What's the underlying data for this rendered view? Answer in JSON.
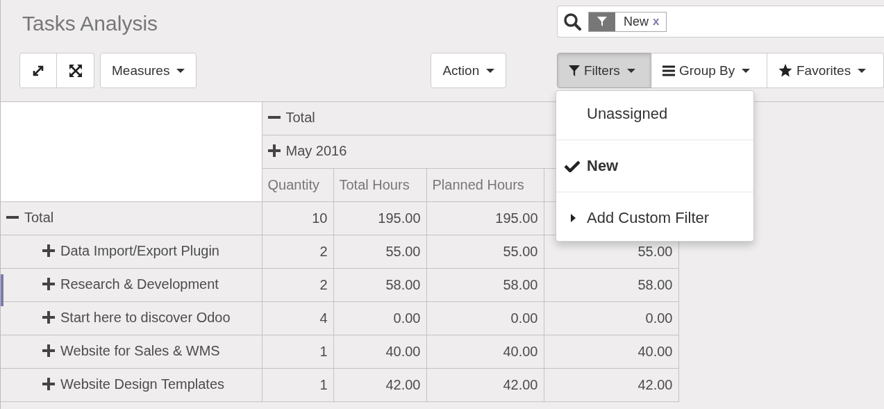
{
  "title": "Tasks Analysis",
  "measures_button": {
    "label": "Measures"
  },
  "action_button": {
    "label": "Action"
  },
  "search": {
    "facets": [
      {
        "label": "New",
        "remove": "x"
      }
    ]
  },
  "search_buttons": [
    {
      "label": "Filters",
      "kind": "filter",
      "selected": true
    },
    {
      "label": "Group By",
      "kind": "group",
      "selected": false
    },
    {
      "label": "Favorites",
      "kind": "star",
      "selected": false
    }
  ],
  "filter_menu": [
    {
      "label": "Unassigned",
      "kind": "option",
      "checked": false
    },
    {
      "label": "New",
      "kind": "option",
      "checked": true
    },
    {
      "label": "Add Custom Filter",
      "kind": "custom",
      "checked": false
    }
  ],
  "table": {
    "column_groups": [
      {
        "label": "Total",
        "expanded": true
      },
      {
        "label": "May 2016",
        "expanded": false
      }
    ],
    "columns": [
      "Quantity",
      "Total Hours",
      "Planned Hours"
    ],
    "total_row": {
      "label": "Total",
      "expanded": true,
      "values": [
        "10",
        "195.00",
        "195.00"
      ]
    },
    "rows": [
      {
        "label": "Data Import/Export Plugin",
        "expanded": false,
        "values": [
          "2",
          "55.00",
          "55.00",
          "55.00"
        ]
      },
      {
        "label": "Research & Development",
        "expanded": false,
        "values": [
          "2",
          "58.00",
          "58.00",
          "58.00"
        ]
      },
      {
        "label": "Start here to discover Odoo",
        "expanded": false,
        "values": [
          "4",
          "0.00",
          "0.00",
          "0.00"
        ]
      },
      {
        "label": "Website for Sales & WMS",
        "expanded": false,
        "values": [
          "1",
          "40.00",
          "40.00",
          "40.00"
        ]
      },
      {
        "label": "Website Design Templates",
        "expanded": false,
        "values": [
          "1",
          "42.00",
          "42.00",
          "42.00"
        ]
      }
    ]
  }
}
